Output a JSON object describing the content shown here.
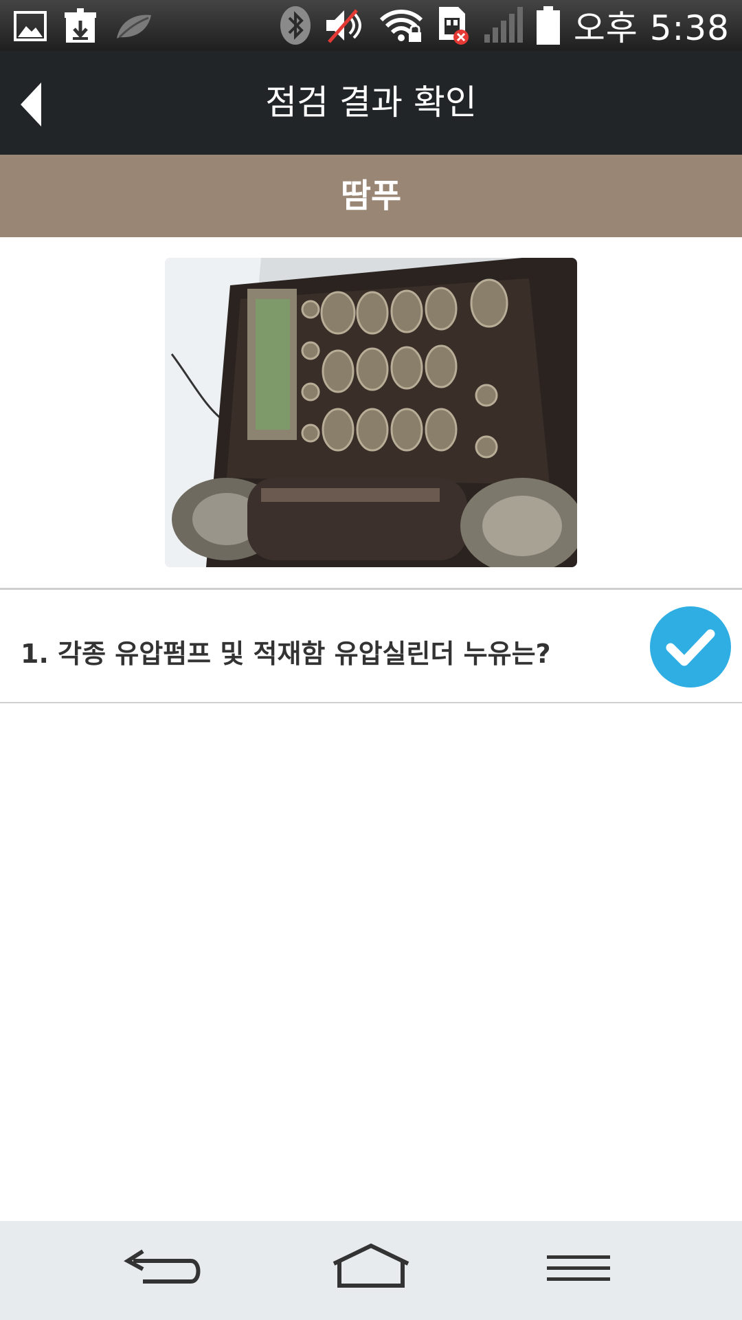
{
  "status_bar": {
    "time": "오후 5:38",
    "icons": [
      "gallery-icon",
      "download-icon",
      "leaf-icon",
      "bluetooth-icon",
      "mute-icon",
      "wifi-lock-icon",
      "sim-error-icon",
      "signal-icon",
      "battery-icon"
    ]
  },
  "app_bar": {
    "title": "점검 결과 확인",
    "back_icon": "back-arrow-icon"
  },
  "category": {
    "label": "땀푸"
  },
  "photo": {
    "subject": "inspection-photo"
  },
  "checklist": {
    "items": [
      {
        "text": "1. 각종 유압펌프 및 적재함 유압실린더 누유는?",
        "checked": true
      }
    ]
  },
  "nav_bar": {
    "buttons": [
      "back-nav-icon",
      "home-nav-icon",
      "menu-nav-icon"
    ]
  },
  "colors": {
    "status_bar": "#2b2b2b",
    "app_bar": "#212528",
    "category_band": "#998674",
    "check_blue": "#2eaee3",
    "nav_bar": "#e8ebee"
  }
}
